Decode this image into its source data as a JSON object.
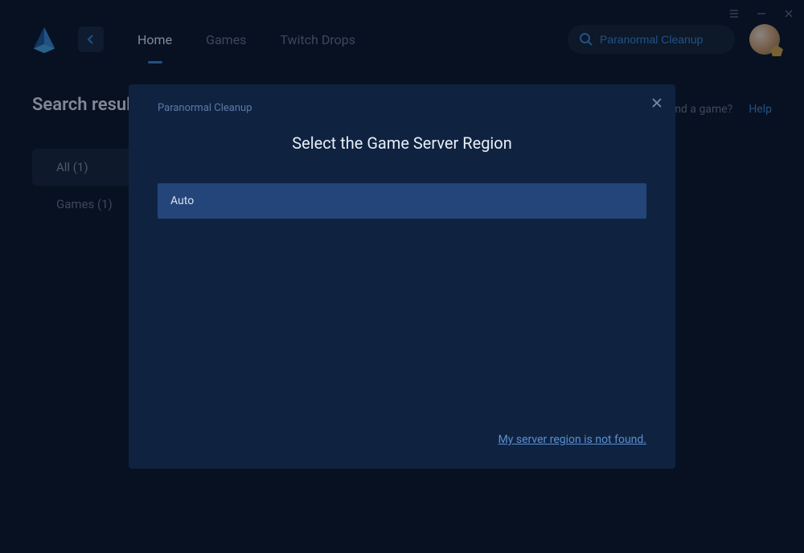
{
  "nav": {
    "items": [
      {
        "label": "Home",
        "active": true
      },
      {
        "label": "Games",
        "active": false
      },
      {
        "label": "Twitch Drops",
        "active": false
      }
    ]
  },
  "search": {
    "value": "Paranormal Cleanup"
  },
  "page": {
    "heading": "Search results"
  },
  "filters": {
    "items": [
      {
        "label": "All (1)",
        "active": true
      },
      {
        "label": "Games (1)",
        "active": false
      }
    ]
  },
  "help": {
    "question": "Can't find a game?",
    "link": "Help"
  },
  "modal": {
    "subtitle": "Paranormal Cleanup",
    "title": "Select the Game Server Region",
    "options": [
      {
        "label": "Auto"
      }
    ],
    "not_found": "My server region is not found."
  }
}
